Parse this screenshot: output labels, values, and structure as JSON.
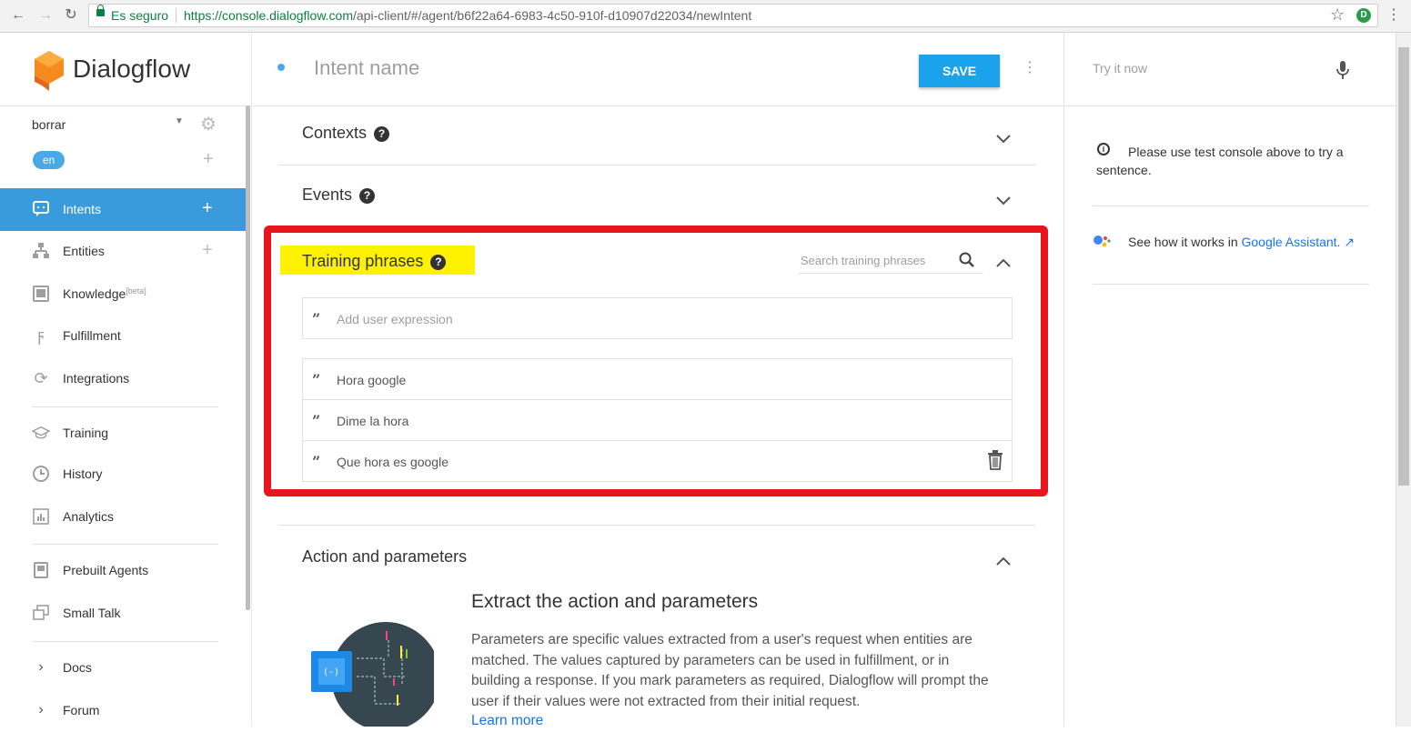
{
  "browser": {
    "secure_label": "Es seguro",
    "url_host": "https://console.dialogflow.com",
    "url_path": "/api-client/#/agent/b6f22a64-6983-4c50-910f-d10907d22034/newIntent"
  },
  "sidebar": {
    "brand": "Dialogflow",
    "agent_name": "borrar",
    "language": "en",
    "items": [
      {
        "label": "Intents",
        "icon": "chat-icon"
      },
      {
        "label": "Entities",
        "icon": "hierarchy-icon"
      },
      {
        "label": "Knowledge",
        "badge": "[beta]",
        "icon": "book-icon"
      },
      {
        "label": "Fulfillment",
        "icon": "bolt-icon"
      },
      {
        "label": "Integrations",
        "icon": "sync-icon"
      },
      {
        "label": "Training",
        "icon": "graduation-cap-icon"
      },
      {
        "label": "History",
        "icon": "clock-icon"
      },
      {
        "label": "Analytics",
        "icon": "bar-chart-icon"
      },
      {
        "label": "Prebuilt Agents",
        "icon": "bookmark-icon"
      },
      {
        "label": "Small Talk",
        "icon": "chat-bubbles-icon"
      },
      {
        "label": "Docs",
        "icon": "chevron-right-icon"
      },
      {
        "label": "Forum",
        "icon": "chevron-right-icon"
      }
    ]
  },
  "main": {
    "intent_name_placeholder": "Intent name",
    "save_label": "SAVE",
    "contexts_title": "Contexts",
    "events_title": "Events",
    "training": {
      "title": "Training phrases",
      "search_placeholder": "Search training phrases",
      "add_placeholder": "Add user expression",
      "phrases": [
        "Hora google",
        "Dime la hora",
        "Que hora es google"
      ]
    },
    "action": {
      "title": "Action and parameters",
      "extract_title": "Extract the action and parameters",
      "extract_text": "Parameters are specific values extracted from a user's request when entities are matched. The values captured by parameters can be used in fulfillment, or in building a response. If you mark parameters as required, Dialogflow will prompt the user if their values were not extracted from their initial request.",
      "learn_more": "Learn more"
    }
  },
  "right": {
    "try_placeholder": "Try it now",
    "info_text": "Please use test console above to try a sentence.",
    "ga_prefix": "See how it works in ",
    "ga_link": "Google Assistant."
  },
  "colors": {
    "accent": "#1aa3ea",
    "nav_active": "#3a9bdc",
    "highlight": "#fff200",
    "annotation_box": "#e8161c"
  }
}
